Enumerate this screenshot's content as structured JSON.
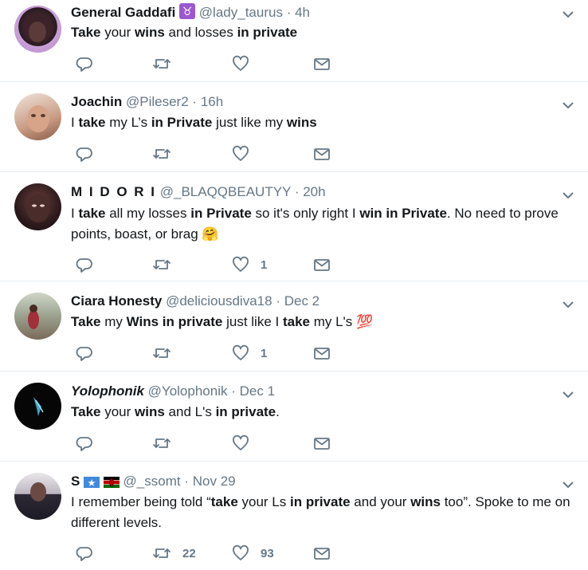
{
  "tweets": [
    {
      "name": "General Gaddafi",
      "handle": "@lady_taurus",
      "time": "4h",
      "badge": "♉",
      "body_html": "<b>Take</b> your <b>wins</b> and losses <b>in private</b>",
      "reply_count": "",
      "retweet_count": "",
      "like_count": ""
    },
    {
      "name": "Joachin",
      "handle": "@Pileser2",
      "time": "16h",
      "body_html": "I <b>take</b> my L’s <b>in Private</b> just like my <b>wins</b>",
      "reply_count": "",
      "retweet_count": "",
      "like_count": ""
    },
    {
      "name": "M I D O R I",
      "handle": "@_BLAQQBEAUTYY",
      "time": "20h",
      "body_html": "I <b>take</b> all my losses <b>in Private</b> so it's only right I <b>win in Private</b>. No need to prove points, boast, or brag 🤗",
      "reply_count": "",
      "retweet_count": "",
      "like_count": "1"
    },
    {
      "name": "Ciara Honesty",
      "handle": "@deliciousdiva18",
      "time": "Dec 2",
      "body_html": "<b>Take</b> my <b>Wins in private</b> just like I <b>take</b> my L's 💯",
      "reply_count": "",
      "retweet_count": "",
      "like_count": "1"
    },
    {
      "name": "Yolophonik",
      "handle": "@Yolophonik",
      "time": "Dec 1",
      "body_html": "<b>Take</b> your <b>wins</b> and L's <b>in private</b>.",
      "reply_count": "",
      "retweet_count": "",
      "like_count": ""
    },
    {
      "name": "S",
      "handle": "@_ssomt",
      "time": "Nov 29",
      "body_html": "I remember being told “<b>take</b> your Ls <b>in private</b> and your <b>wins</b> too”. Spoke to me on different levels.",
      "reply_count": "",
      "retweet_count": "22",
      "like_count": "93"
    }
  ],
  "separator": "·",
  "icons": {
    "reply": "reply-icon",
    "retweet": "retweet-icon",
    "like": "heart-icon",
    "dm": "envelope-icon",
    "caret": "chevron-down-icon"
  },
  "colors": {
    "text": "#14171a",
    "secondary": "#657786",
    "divider": "#e6ecf0",
    "badge": "#9b59d0"
  }
}
